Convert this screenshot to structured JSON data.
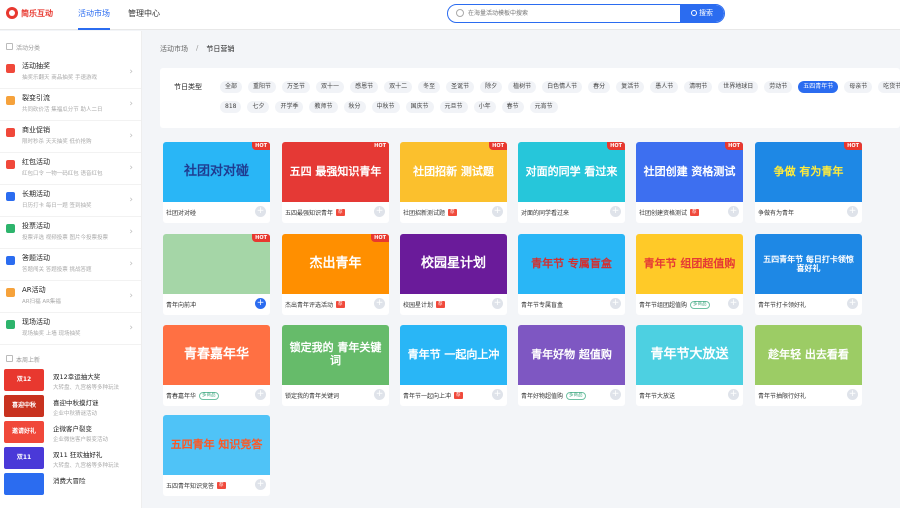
{
  "app": {
    "logo_text": "简乐互动"
  },
  "nav": [
    {
      "label": "活动市场"
    },
    {
      "label": "管理中心"
    }
  ],
  "search": {
    "placeholder": "在海量活动模板中搜索",
    "button": "搜索"
  },
  "sidebar": {
    "section_title": "活动分类",
    "items": [
      {
        "title": "活动抽奖",
        "desc": "抽奖乐翻天  商品抽奖  手速游戏",
        "color": "#f0483a"
      },
      {
        "title": "裂变引流",
        "desc": "共同砍价活  集福瓜分节  助人二日",
        "color": "#f6a23b"
      },
      {
        "title": "商业促销",
        "desc": "限时秒杀  天天抽奖  低价抢购",
        "color": "#f0483a"
      },
      {
        "title": "红包活动",
        "desc": "红包口令  一物一码红包  语音红包",
        "color": "#f0483a"
      },
      {
        "title": "长期活动",
        "desc": "日历打卡  每日一题  签到抽奖",
        "color": "#2b6cf0"
      },
      {
        "title": "投票活动",
        "desc": "投票评选  视频投票  图片今投票投票",
        "color": "#2db46c"
      },
      {
        "title": "答题活动",
        "desc": "答题闯关  答题投票  挑战答题",
        "color": "#2b6cf0"
      },
      {
        "title": "AR活动",
        "desc": "AR扫福  AR集福",
        "color": "#f6a23b"
      },
      {
        "title": "现场活动",
        "desc": "现场抽奖  上墙  现场抽奖",
        "color": "#2db46c"
      }
    ],
    "new_section_title": "本周上新",
    "new_items": [
      {
        "thumb": "双12",
        "title": "双12幸运抽大奖",
        "desc": "大转盘、九宫格等多种玩法",
        "color": "#e8382f"
      },
      {
        "thumb": "喜迎中秋",
        "title": "喜迎中秋摸灯谜",
        "desc": "企业中秋猜谜活动",
        "color": "#c8321f"
      },
      {
        "title": "企微客户裂变",
        "thumb": "邀请好礼",
        "desc": "企业微信客户裂变活动",
        "color": "#f0483a"
      },
      {
        "thumb": "双11",
        "title": "双11 狂欢抽好礼",
        "desc": "大转盘、九宫格等多种玩法",
        "color": "#4a39d8"
      },
      {
        "thumb": "",
        "title": "消费大冒险",
        "desc": "",
        "color": "#2b6cf0"
      }
    ]
  },
  "breadcrumb": {
    "root": "活动市场",
    "sep": "/",
    "current": "节日营销"
  },
  "filter": {
    "label": "节日类型",
    "row1": [
      {
        "label": "全部"
      },
      {
        "label": "重阳节"
      },
      {
        "label": "万圣节"
      },
      {
        "label": "双十一"
      },
      {
        "label": "感恩节"
      },
      {
        "label": "双十二"
      },
      {
        "label": "冬至"
      },
      {
        "label": "圣诞节"
      },
      {
        "label": "除夕"
      },
      {
        "label": "植树节"
      },
      {
        "label": "白色情人节"
      },
      {
        "label": "春分"
      },
      {
        "label": "复活节"
      },
      {
        "label": "愚人节"
      },
      {
        "label": "清明节"
      },
      {
        "label": "世界地球日"
      },
      {
        "label": "劳动节"
      },
      {
        "label": "五四青年节",
        "active": true
      },
      {
        "label": "母亲节"
      },
      {
        "label": "吃货节"
      }
    ],
    "row2": [
      {
        "label": "818"
      },
      {
        "label": "七夕"
      },
      {
        "label": "开学季"
      },
      {
        "label": "教师节"
      },
      {
        "label": "秋分"
      },
      {
        "label": "中秋节"
      },
      {
        "label": "国庆节"
      },
      {
        "label": "元旦节"
      },
      {
        "label": "小年"
      },
      {
        "label": "春节"
      },
      {
        "label": "元宵节"
      }
    ]
  },
  "cards": [
    {
      "title": "社团对对碰",
      "img_text": "社团对对碰",
      "bg": "#29b6f6",
      "fg": "#1f3c91",
      "hot": true
    },
    {
      "title": "五四最强知识青年",
      "img_text": "五四 最强知识青年",
      "bg": "#e53935",
      "fg": "#ffffff",
      "hot": true,
      "vip": true
    },
    {
      "title": "社团招新测试题",
      "img_text": "社团招新 测试题",
      "bg": "#fbc02d",
      "fg": "#ffffff",
      "hot": true,
      "vip": true
    },
    {
      "title": "对面的同学看过来",
      "img_text": "对面的同学 看过来",
      "bg": "#26c6da",
      "fg": "#ffffff",
      "hot": true
    },
    {
      "title": "社团创建资格测试",
      "img_text": "社团创建 资格测试",
      "bg": "#3d6ff0",
      "fg": "#ffffff",
      "hot": true,
      "vip": true
    },
    {
      "title": "争做有为青年",
      "img_text": "争做 有为青年",
      "bg": "#1e88e5",
      "fg": "#ffeb3b",
      "hot": true
    },
    {
      "title": "青年向前冲",
      "img_text": "",
      "bg": "#a5d6a7",
      "fg": "#ffffff",
      "hot": true,
      "add_active": true
    },
    {
      "title": "杰出青年评选活动",
      "img_text": "杰出青年",
      "bg": "#ff8f00",
      "fg": "#ffffff",
      "hot": true,
      "vip": true
    },
    {
      "title": "校园星计划",
      "img_text": "校园星计划",
      "bg": "#6a1b9a",
      "fg": "#ffffff",
      "vip": true
    },
    {
      "title": "青年节专属盲盒",
      "img_text": "青年节 专属盲盒",
      "bg": "#29b6f6",
      "fg": "#d32f2f"
    },
    {
      "title": "青年节组团超值购",
      "img_text": "青年节 组团超值购",
      "bg": "#ffca28",
      "fg": "#e53935",
      "plugin": "多商品"
    },
    {
      "title": "青年节打卡领好礼",
      "img_text": "五四青年节 每日打卡领惊喜好礼",
      "bg": "#1e88e5",
      "fg": "#ffffff"
    },
    {
      "title": "青春嘉年华",
      "img_text": "青春嘉年华",
      "bg": "#ff7043",
      "fg": "#ffffff",
      "plugin": "多商品"
    },
    {
      "title": "锁定我的青年关键词",
      "img_text": "锁定我的 青年关键词",
      "bg": "#66bb6a",
      "fg": "#ffffff"
    },
    {
      "title": "青年节一起向上冲",
      "img_text": "青年节 一起向上冲",
      "bg": "#29b6f6",
      "fg": "#ffffff",
      "vip": true
    },
    {
      "title": "青年好物超值购",
      "img_text": "青年好物 超值购",
      "bg": "#7e57c2",
      "fg": "#ffffff",
      "plugin": "多商品"
    },
    {
      "title": "青年节大放送",
      "img_text": "青年节大放送",
      "bg": "#4dd0e1",
      "fg": "#ffffff"
    },
    {
      "title": "青年节抽限行好礼",
      "img_text": "趁年轻 出去看看",
      "bg": "#9ccc65",
      "fg": "#ffffff"
    },
    {
      "title": "五四青年知识竞答",
      "img_text": "五四青年 知识竞答",
      "bg": "#4fc3f7",
      "fg": "#ff5722",
      "vip": true
    }
  ],
  "badges": {
    "hot": "HOT",
    "vip": "荐",
    "add": "+"
  }
}
